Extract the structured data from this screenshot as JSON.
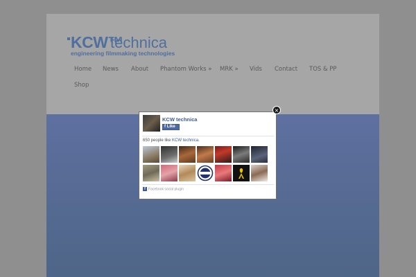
{
  "logo": {
    "brand": "KCW™",
    "name": "technica",
    "tagline": "engineering filmmaking technologies",
    "color": "#4f6f9e"
  },
  "nav": {
    "items": [
      {
        "label": "Home"
      },
      {
        "label": "News"
      },
      {
        "label": "About"
      },
      {
        "label": "Phantom Works »"
      },
      {
        "label": "MRK »"
      },
      {
        "label": "Vids"
      },
      {
        "label": "Contact"
      },
      {
        "label": "TOS & PP"
      },
      {
        "label": "Shop"
      }
    ]
  },
  "popup": {
    "close_icon": "×",
    "page_name": "KCW technica",
    "like_button": "Like",
    "likes_count": "650 people like",
    "likes_link": "KCW technica",
    "likes_period": ".",
    "plugin_label": "Facebook social plugin",
    "fb_icon": "f",
    "faces": [
      {
        "icon": "face-photo"
      },
      {
        "icon": "face-photo"
      },
      {
        "icon": "face-photo"
      },
      {
        "icon": "face-photo"
      },
      {
        "icon": "face-photo"
      },
      {
        "icon": "face-photo"
      },
      {
        "icon": "face-photo"
      },
      {
        "icon": "face-photo"
      },
      {
        "icon": "face-photo"
      },
      {
        "icon": "face-photo"
      },
      {
        "icon": "face-photo"
      },
      {
        "icon": "face-photo"
      },
      {
        "icon": "face-photo"
      },
      {
        "icon": "face-photo"
      }
    ]
  },
  "colors": {
    "overlay": "#8f8f8f",
    "page": "#a6a6a6",
    "hero": "#5a6d98",
    "facebook": "#3b5998"
  }
}
